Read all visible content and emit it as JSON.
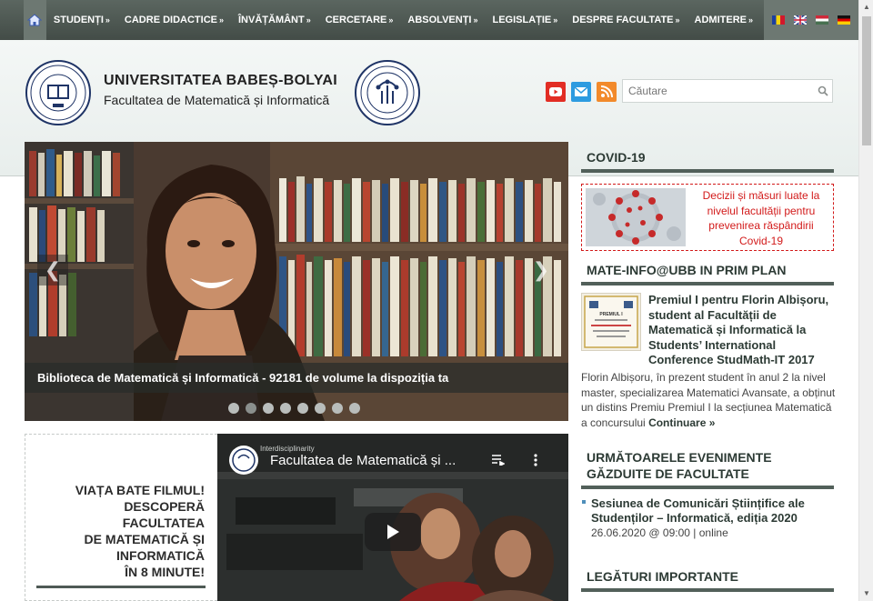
{
  "nav": {
    "items": [
      {
        "label": "STUDENȚI"
      },
      {
        "label": "CADRE DIDACTICE"
      },
      {
        "label": "ÎNVĂȚĂMÂNT"
      },
      {
        "label": "CERCETARE"
      },
      {
        "label": "ABSOLVENȚI"
      },
      {
        "label": "LEGISLAȚIE"
      },
      {
        "label": "DESPRE FACULTATE"
      },
      {
        "label": "ADMITERE"
      }
    ],
    "arrow": "»",
    "languages": [
      "ro",
      "en",
      "hu",
      "de"
    ]
  },
  "header": {
    "university": "UNIVERSITATEA BABEȘ-BOLYAI",
    "faculty": "Facultatea de Matematică și Informatică",
    "search_placeholder": "Căutare",
    "social_icons": [
      "youtube-icon",
      "mail-icon",
      "rss-icon"
    ]
  },
  "slider": {
    "caption": "Biblioteca de Matematică și Informatică - 92181 de volume la dispoziția ta",
    "slide_count": 8,
    "active_slide": 2,
    "prev_symbol": "❮",
    "next_symbol": "❯"
  },
  "promo": {
    "text_lines": [
      "VIAȚA BATE FILMUL!",
      "DESCOPERĂ",
      "FACULTATEA",
      "DE MATEMATICĂ ȘI",
      "INFORMATICĂ",
      "ÎN 8 MINUTE!"
    ]
  },
  "video": {
    "channel": "Interdisciplinarity",
    "title": "Facultatea de Matematică și ..."
  },
  "sidebar": {
    "covid": {
      "heading": "COVID-19",
      "text": "Decizii și măsuri luate la nivelul facultății pentru prevenirea răspândirii Covid-19"
    },
    "news": {
      "heading": "MATE-INFO@UBB IN PRIM PLAN",
      "title": "Premiul I pentru Florin Albișoru, student al Facultății de Matematică și Informatică la Students’ International Conference StudMath-IT 2017",
      "body": "Florin Albișoru, în prezent student în anul 2 la nivel master, specializarea Matematici Avansate, a obținut un distins Premiu Premiul I la secțiunea Matematică a concursului",
      "more": "Continuare »",
      "image_title": "PREMIUL I"
    },
    "events": {
      "heading": "URMĂTOARELE EVENIMENTE GĂZDUITE DE FACULTATE",
      "title": "Sesiunea de Comunicări Științifice ale Studenților – Informatică, ediția 2020",
      "date": "26.06.2020 @ 09:00 | online"
    },
    "links": {
      "heading": "LEGĂTURI IMPORTANTE"
    }
  },
  "colors": {
    "nav_bg": "#4b5550",
    "accent_dark": "#52605a",
    "covid_red": "#d21a1a"
  }
}
